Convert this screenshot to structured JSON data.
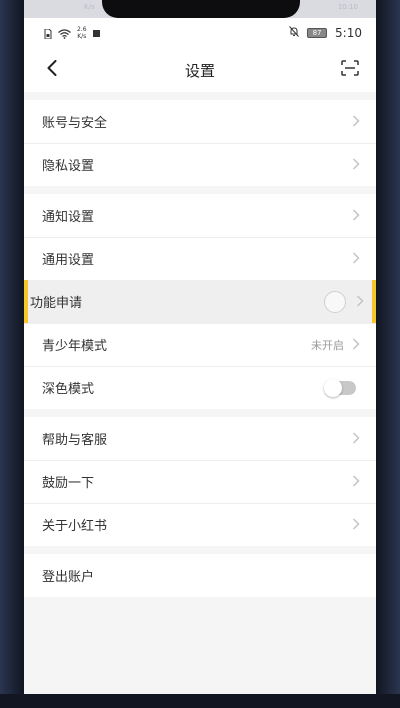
{
  "colors": {
    "highlight_border": "#f7c72a",
    "background": "#f5f5f5",
    "chevron": "#c4c4c4"
  },
  "top_strip": {
    "left_text": "K/s",
    "right_text": "10:10"
  },
  "status_bar": {
    "speed_value": "2.6",
    "speed_unit": "K/s",
    "battery": "87",
    "time": "5:10",
    "icons": [
      "sim-icon",
      "wifi-icon",
      "notification-square-icon",
      "bell-off-icon",
      "battery-icon"
    ]
  },
  "header": {
    "title": "设置",
    "back_icon": "chevron-left-icon",
    "right_icon": "scan-icon"
  },
  "groups": [
    {
      "items": [
        {
          "label": "账号与安全"
        },
        {
          "label": "隐私设置"
        }
      ]
    },
    {
      "items": [
        {
          "label": "通知设置"
        },
        {
          "label": "通用设置"
        },
        {
          "label": "功能申请",
          "highlighted": true
        },
        {
          "label": "青少年模式",
          "value": "未开启"
        },
        {
          "label": "深色模式",
          "toggle": false
        }
      ]
    },
    {
      "items": [
        {
          "label": "帮助与客服"
        },
        {
          "label": "鼓励一下"
        },
        {
          "label": "关于小红书"
        }
      ]
    },
    {
      "items": [
        {
          "label": "登出账户"
        }
      ]
    }
  ]
}
